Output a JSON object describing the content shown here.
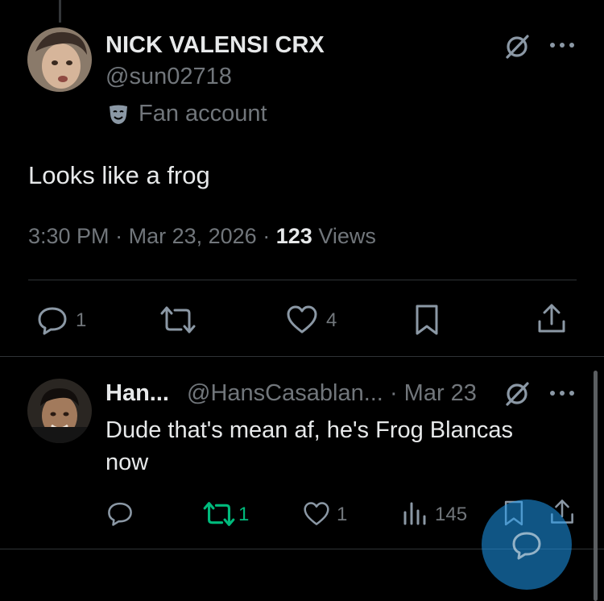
{
  "main_tweet": {
    "author_name": "NICK VALENSI CRX",
    "handle": "@sun02718",
    "label": "Fan account",
    "text": "Looks like a frog",
    "time": "3:30 PM",
    "sep1": "·",
    "date": "Mar 23, 2026",
    "sep2": "·",
    "views_count": "123",
    "views_label": "Views",
    "actions": {
      "reply_count": "1",
      "like_count": "4"
    }
  },
  "reply": {
    "author_name": "Han...",
    "handle": "@HansCasablan...",
    "sep": "·",
    "date": "Mar 23",
    "text": "Dude that's mean af, he's Frog Blancas now",
    "actions": {
      "retweet_count": "1",
      "like_count": "1",
      "views_count": "145"
    }
  },
  "colors": {
    "background": "#000000",
    "text_primary": "#e7e9ea",
    "text_secondary": "#71767b",
    "retweet_green": "#00ba7c",
    "fab_blue": "#1d9bf0"
  },
  "icons": [
    "grok-slash-icon",
    "more-icon",
    "fan-mask-icon",
    "reply-icon",
    "retweet-icon",
    "like-icon",
    "bookmark-icon",
    "share-icon",
    "analytics-icon",
    "compose-reply-icon"
  ]
}
